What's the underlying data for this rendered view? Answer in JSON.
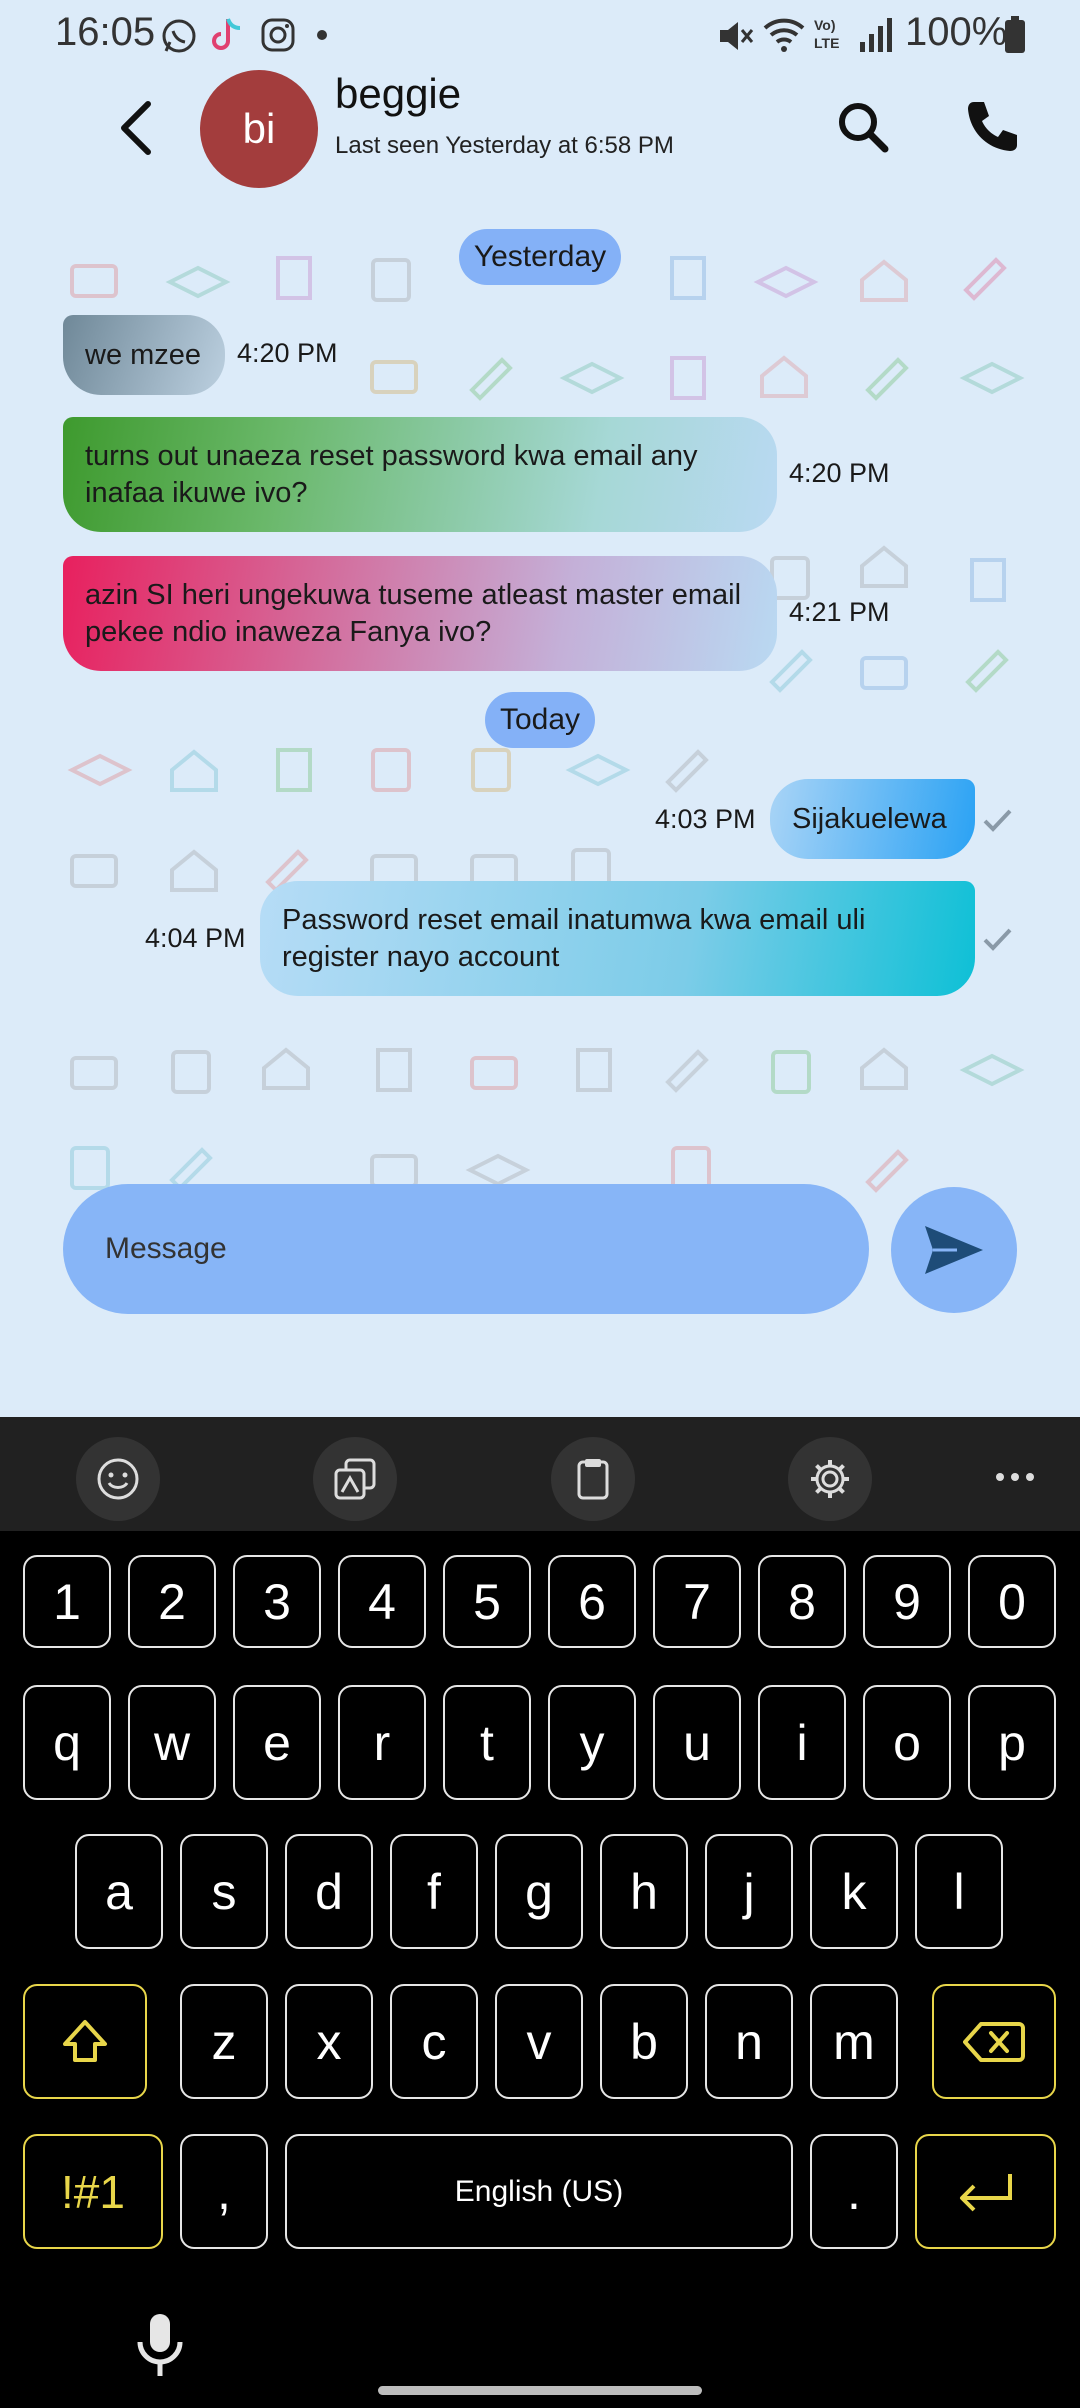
{
  "status": {
    "time": "16:05",
    "battery": "100%"
  },
  "header": {
    "avatar_initials": "bi",
    "name": "beggie",
    "last_seen": "Last seen Yesterday at 6:58 PM"
  },
  "chat": {
    "date_yesterday": "Yesterday",
    "date_today": "Today",
    "messages": [
      {
        "text": "we mzee",
        "time": "4:20 PM",
        "dir": "in"
      },
      {
        "text": "turns out unaeza reset password kwa email any inafaa ikuwe ivo?",
        "time": "4:20 PM",
        "dir": "in"
      },
      {
        "text": "azin SI  heri ungekuwa tuseme atleast master email pekee ndio inaweza Fanya ivo?",
        "time": "4:21 PM",
        "dir": "in"
      },
      {
        "text": "Sijakuelewa",
        "time": "4:03 PM",
        "dir": "out"
      },
      {
        "text": "Password reset email inatumwa kwa email uli register nayo account",
        "time": "4:04 PM",
        "dir": "out"
      }
    ]
  },
  "composer": {
    "placeholder": "Message"
  },
  "keyboard": {
    "numbers": [
      "1",
      "2",
      "3",
      "4",
      "5",
      "6",
      "7",
      "8",
      "9",
      "0"
    ],
    "row1": [
      "q",
      "w",
      "e",
      "r",
      "t",
      "y",
      "u",
      "i",
      "o",
      "p"
    ],
    "row2": [
      "a",
      "s",
      "d",
      "f",
      "g",
      "h",
      "j",
      "k",
      "l"
    ],
    "row3": [
      "z",
      "x",
      "c",
      "v",
      "b",
      "n",
      "m"
    ],
    "symbols_label": "!#1",
    "comma": ",",
    "space_label": "English (US)",
    "period": "."
  },
  "colors": {
    "chat_bg": "#dcebf9",
    "accent": "#87b5f7",
    "keyboard_accent": "#e8d64a",
    "avatar": "#a33d3d"
  }
}
